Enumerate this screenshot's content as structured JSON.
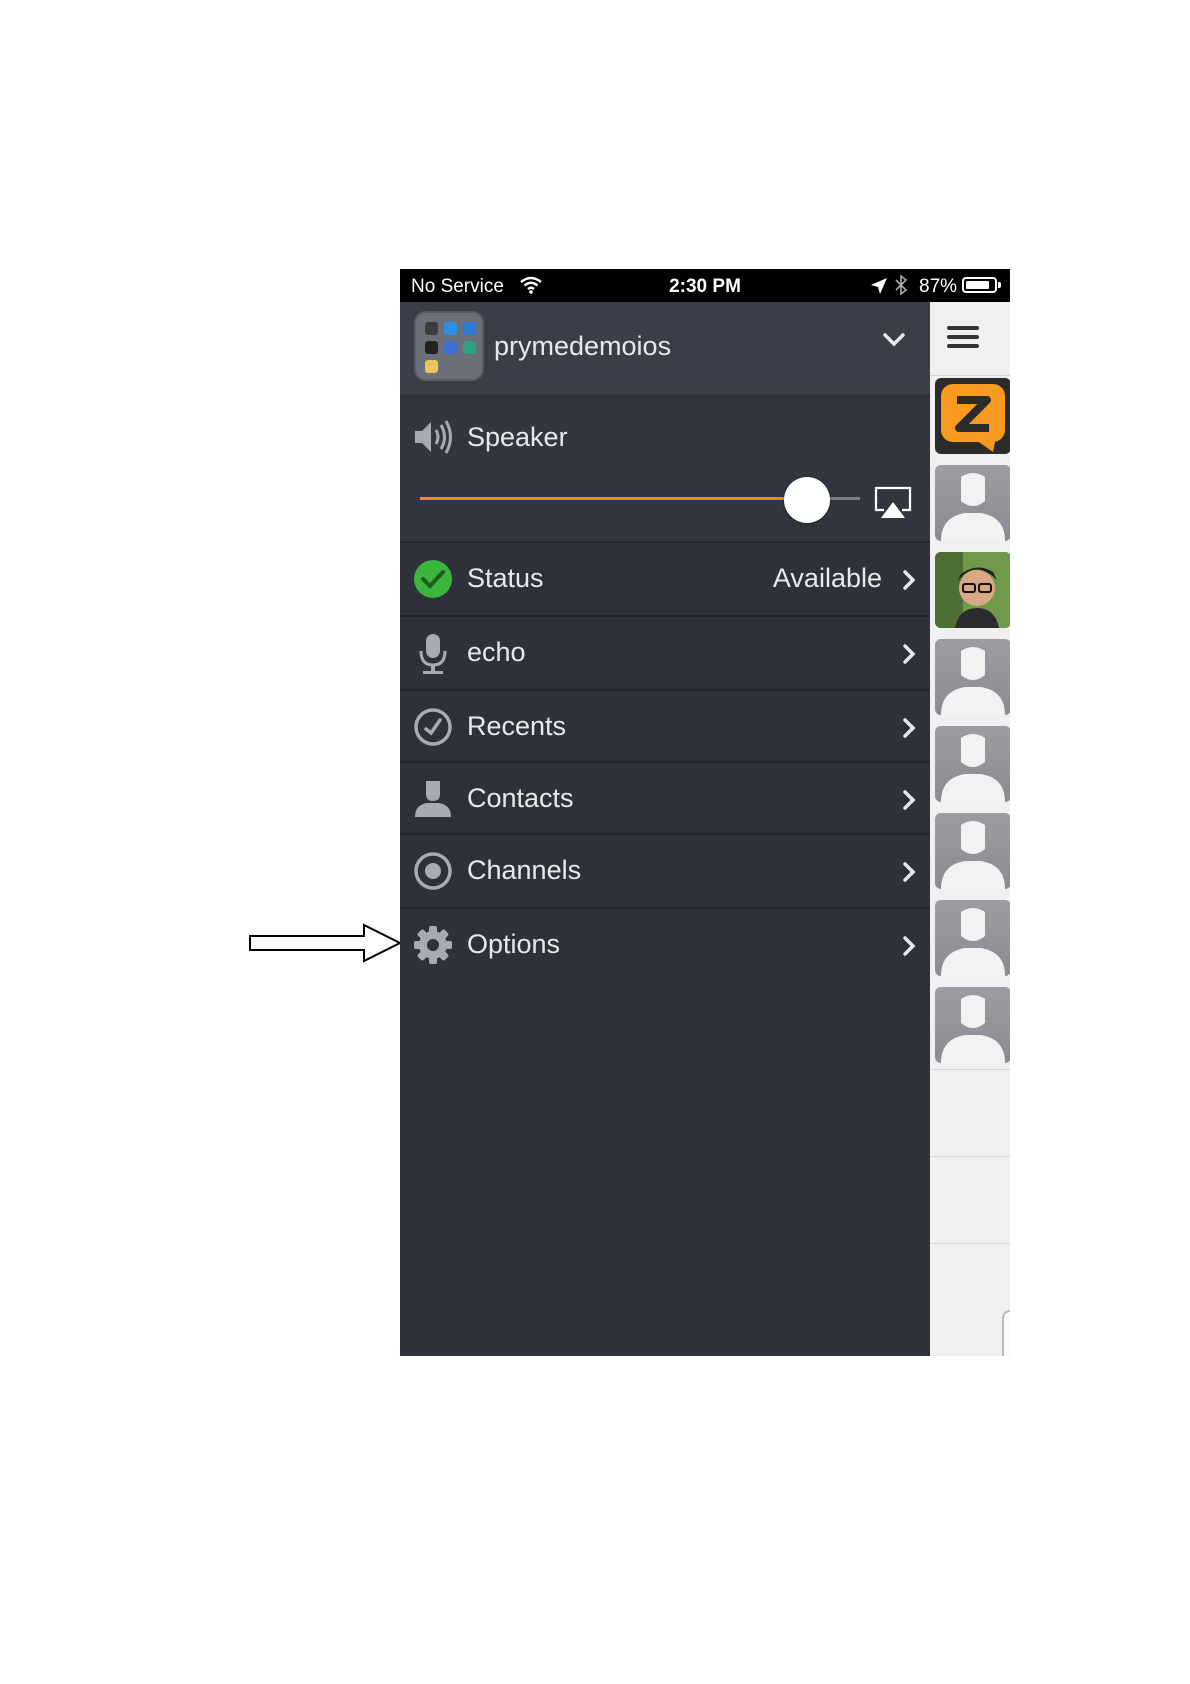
{
  "status_bar": {
    "carrier": "No Service",
    "time": "2:30 PM",
    "battery_percent": "87%",
    "battery_level": 0.87,
    "icons": [
      "wifi-icon",
      "location-arrow-icon",
      "bluetooth-icon",
      "battery-icon"
    ]
  },
  "account": {
    "name": "prymedemoios",
    "avatar_icon": "app-folder-icon"
  },
  "speaker": {
    "label": "Speaker",
    "volume": 0.88,
    "accent_color": "#f08a1c"
  },
  "menu": {
    "status": {
      "label": "Status",
      "value": "Available",
      "status_color": "#3bb53b"
    },
    "items": [
      {
        "label": "echo",
        "icon": "microphone-icon"
      },
      {
        "label": "Recents",
        "icon": "clock-icon"
      },
      {
        "label": "Contacts",
        "icon": "person-icon"
      },
      {
        "label": "Channels",
        "icon": "channel-target-icon"
      },
      {
        "label": "Options",
        "icon": "gear-icon"
      }
    ]
  },
  "sidebar": {
    "menu_icon": "hamburger-menu-icon",
    "tiles": [
      "zello-logo-icon",
      "default-avatar",
      "photo-avatar",
      "default-avatar",
      "default-avatar",
      "default-avatar",
      "default-avatar",
      "default-avatar"
    ]
  },
  "colors": {
    "panel_bg": "#2e3139",
    "text": "#e8e9ec",
    "brand_orange": "#f79a1f"
  }
}
